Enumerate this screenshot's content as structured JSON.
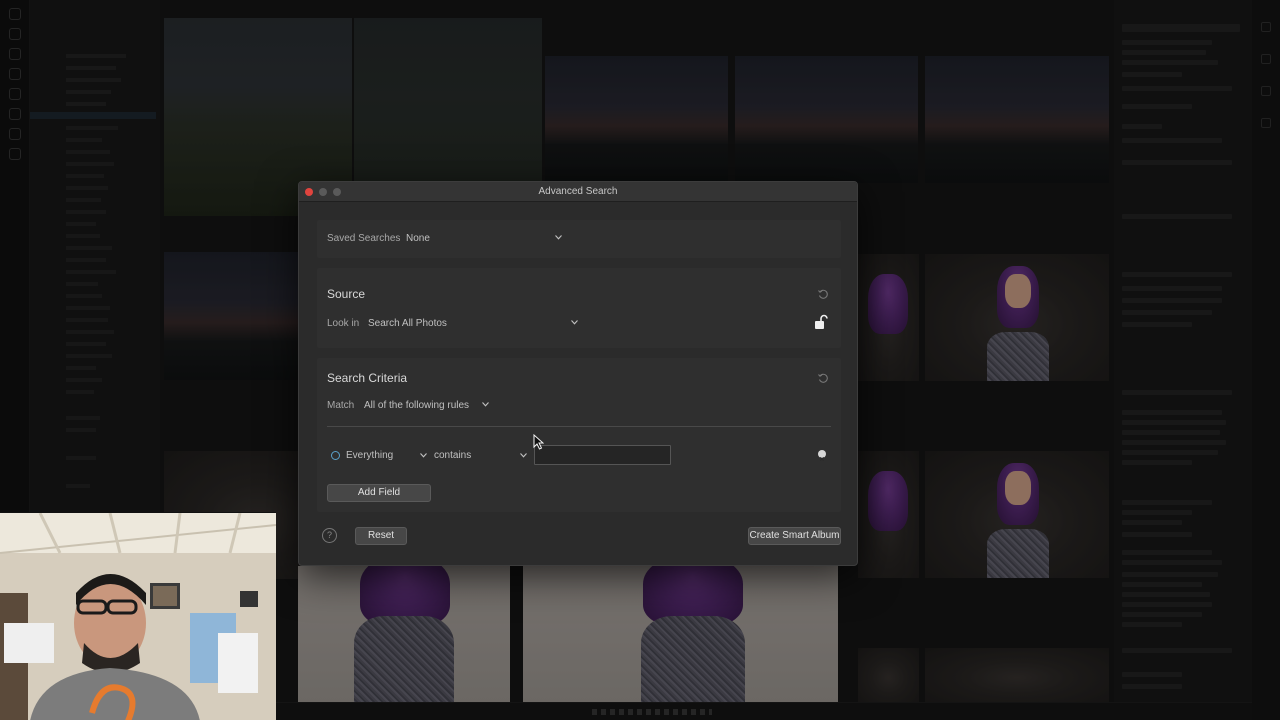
{
  "dialog": {
    "title": "Advanced Search",
    "saved_searches": {
      "label": "Saved Searches",
      "value": "None"
    },
    "source": {
      "heading": "Source",
      "look_in_label": "Look in",
      "look_in_value": "Search All Photos"
    },
    "criteria": {
      "heading": "Search Criteria",
      "match_label": "Match",
      "match_value": "All of the following rules",
      "rule": {
        "field": "Everything",
        "operator": "contains",
        "value": ""
      }
    },
    "add_field_label": "Add Field",
    "help_label": "?",
    "reset_label": "Reset",
    "create_label": "Create Smart Album"
  },
  "icons": {
    "chevron": "chevron-down-icon",
    "revert": "revert-icon",
    "lock": "unlock-icon",
    "remove": "remove-rule-icon",
    "help": "help-icon"
  },
  "colors": {
    "dialog_bg": "#2b2b2b",
    "panel_bg": "#2f2f2f",
    "close_button": "#e0443e",
    "rule_radio": "#5aa0c8"
  }
}
